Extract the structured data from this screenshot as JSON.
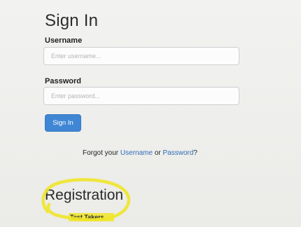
{
  "signin": {
    "title": "Sign In",
    "username_label": "Username",
    "username_placeholder": "Enter username...",
    "password_label": "Password",
    "password_placeholder": "Enter password...",
    "button_label": "Sign In"
  },
  "forgot": {
    "prefix": "Forgot your ",
    "username_link": "Username",
    "middle": " or ",
    "password_link": "Password",
    "suffix": "?"
  },
  "registration": {
    "title": "Registration",
    "test_takers_label": "Test Takers"
  },
  "colors": {
    "button_blue": "#3f86d4",
    "link_blue": "#2f6db5",
    "highlight_yellow": "#f0e628"
  }
}
